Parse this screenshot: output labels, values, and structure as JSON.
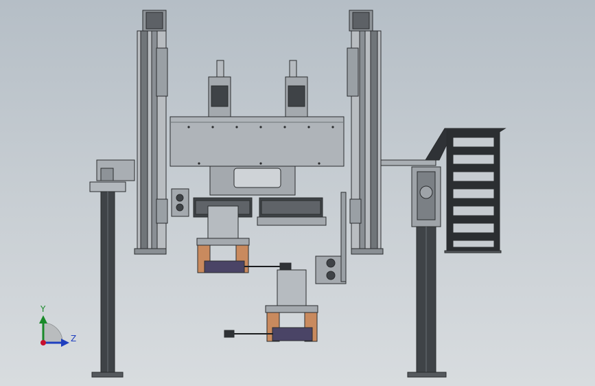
{
  "triad": {
    "y_label": "Y",
    "z_label": "Z",
    "colors": {
      "y": "#1a8a2a",
      "z": "#1f3fbf",
      "x": "#c8102e"
    }
  },
  "colors": {
    "background_top": "#b5bec6",
    "background_bottom": "#d8dcdf",
    "steel": "#a7acb1",
    "dark_steel": "#3e4246",
    "orange_block": "#c98a5e",
    "coil": "#4a4466"
  }
}
